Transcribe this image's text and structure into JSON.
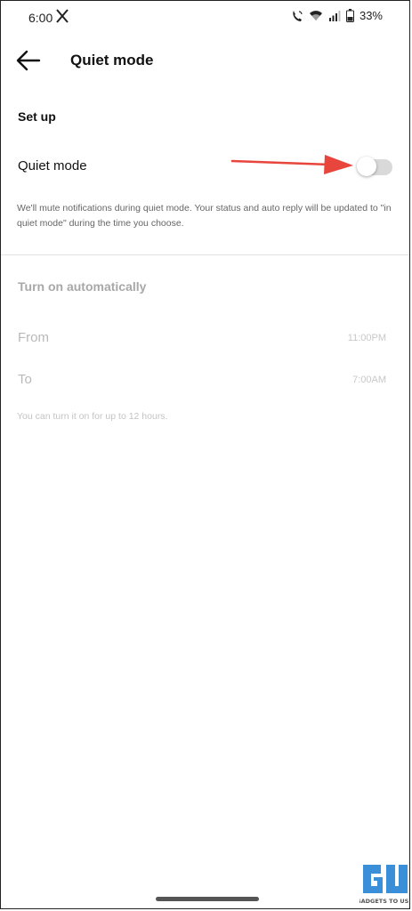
{
  "status_bar": {
    "time": "6:00",
    "battery_percent": "33%",
    "icons": [
      "x-app-icon",
      "wifi-calling-icon",
      "wifi-icon",
      "signal-icon",
      "battery-icon"
    ]
  },
  "header": {
    "title": "Quiet mode",
    "back_icon": "arrow-left-icon"
  },
  "setup": {
    "section_title": "Set up",
    "toggle_label": "Quiet mode",
    "toggle_on": false,
    "description": "We'll mute notifications during quiet mode. Your status and auto reply will be updated to \"in quiet mode\" during the time you choose.",
    "annotation_color": "#e8453c"
  },
  "auto": {
    "section_title": "Turn on automatically",
    "from_label": "From",
    "from_value": "11:00PM",
    "to_label": "To",
    "to_value": "7:00AM",
    "note": "You can turn it on for up to 12 hours."
  },
  "watermark": {
    "text": "GADGETS TO USE",
    "color": "#3b8fd8"
  }
}
